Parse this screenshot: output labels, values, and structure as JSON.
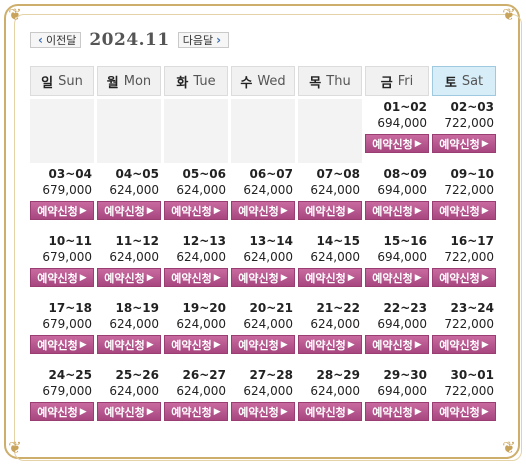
{
  "nav": {
    "prev_label": "이전달",
    "next_label": "다음달",
    "month": "2024.11"
  },
  "weekdays": [
    {
      "ko": "일",
      "en": "Sun"
    },
    {
      "ko": "월",
      "en": "Mon"
    },
    {
      "ko": "화",
      "en": "Tue"
    },
    {
      "ko": "수",
      "en": "Wed"
    },
    {
      "ko": "목",
      "en": "Thu"
    },
    {
      "ko": "금",
      "en": "Fri"
    },
    {
      "ko": "토",
      "en": "Sat"
    }
  ],
  "reserve_label": "예약신청",
  "weeks": [
    [
      null,
      null,
      null,
      null,
      null,
      {
        "date": "01~02",
        "price": "694,000"
      },
      {
        "date": "02~03",
        "price": "722,000"
      }
    ],
    [
      {
        "date": "03~04",
        "price": "679,000"
      },
      {
        "date": "04~05",
        "price": "624,000"
      },
      {
        "date": "05~06",
        "price": "624,000"
      },
      {
        "date": "06~07",
        "price": "624,000"
      },
      {
        "date": "07~08",
        "price": "624,000"
      },
      {
        "date": "08~09",
        "price": "694,000"
      },
      {
        "date": "09~10",
        "price": "722,000"
      }
    ],
    [
      {
        "date": "10~11",
        "price": "679,000"
      },
      {
        "date": "11~12",
        "price": "624,000"
      },
      {
        "date": "12~13",
        "price": "624,000"
      },
      {
        "date": "13~14",
        "price": "624,000"
      },
      {
        "date": "14~15",
        "price": "624,000"
      },
      {
        "date": "15~16",
        "price": "694,000"
      },
      {
        "date": "16~17",
        "price": "722,000"
      }
    ],
    [
      {
        "date": "17~18",
        "price": "679,000"
      },
      {
        "date": "18~19",
        "price": "624,000"
      },
      {
        "date": "19~20",
        "price": "624,000"
      },
      {
        "date": "20~21",
        "price": "624,000"
      },
      {
        "date": "21~22",
        "price": "624,000"
      },
      {
        "date": "22~23",
        "price": "694,000"
      },
      {
        "date": "23~24",
        "price": "722,000"
      }
    ],
    [
      {
        "date": "24~25",
        "price": "679,000"
      },
      {
        "date": "25~26",
        "price": "624,000"
      },
      {
        "date": "26~27",
        "price": "624,000"
      },
      {
        "date": "27~28",
        "price": "624,000"
      },
      {
        "date": "28~29",
        "price": "624,000"
      },
      {
        "date": "29~30",
        "price": "694,000"
      },
      {
        "date": "30~01",
        "price": "722,000"
      }
    ]
  ]
}
